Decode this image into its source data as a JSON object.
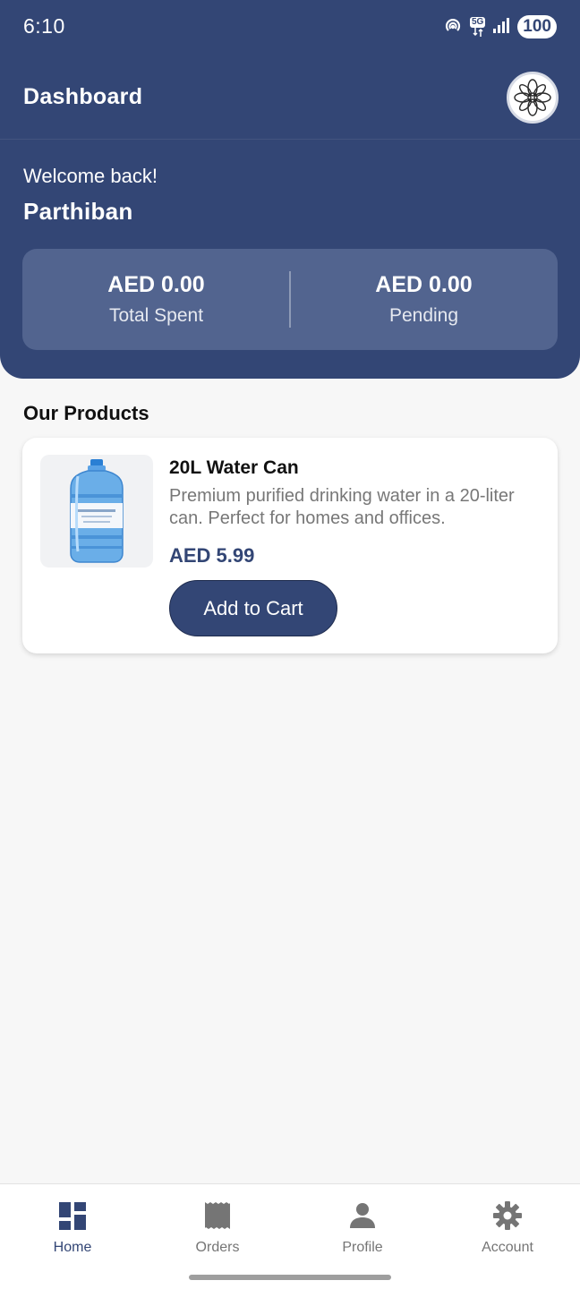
{
  "status_bar": {
    "time": "6:10",
    "network": "5G",
    "battery": "100"
  },
  "app_bar": {
    "title": "Dashboard",
    "logo_icon": "ornament-logo-icon"
  },
  "welcome": {
    "greeting": "Welcome back!",
    "username": "Parthiban"
  },
  "stats": [
    {
      "value": "AED 0.00",
      "label": "Total Spent"
    },
    {
      "value": "AED 0.00",
      "label": "Pending"
    }
  ],
  "products_section": {
    "title": "Our Products",
    "items": [
      {
        "name": "20L Water Can",
        "description": "Premium purified drinking water in a 20-liter can. Perfect for homes and offices.",
        "price": "AED 5.99",
        "button_label": "Add to Cart",
        "image_icon": "water-can-image"
      }
    ]
  },
  "bottom_nav": {
    "items": [
      {
        "label": "Home",
        "icon": "dashboard-icon",
        "active": true
      },
      {
        "label": "Orders",
        "icon": "receipt-icon",
        "active": false
      },
      {
        "label": "Profile",
        "icon": "person-icon",
        "active": false
      },
      {
        "label": "Account",
        "icon": "gear-icon",
        "active": false
      }
    ]
  },
  "colors": {
    "primary": "#334675",
    "stats_card": "#52648f",
    "background": "#f7f7f7",
    "muted_text": "#777777"
  }
}
